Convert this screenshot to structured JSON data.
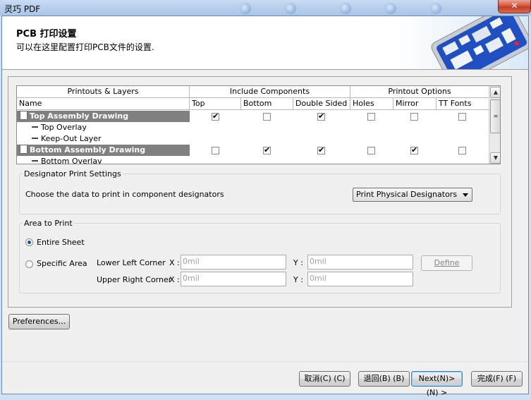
{
  "window": {
    "title": "灵巧 PDF",
    "close_glyph": "✕"
  },
  "header": {
    "title": "PCB 打印设置",
    "subtitle": "可以在这里配置打印PCB文件的设置."
  },
  "grid": {
    "group_headers": [
      "Printouts & Layers",
      "Include Components",
      "Printout Options"
    ],
    "columns": [
      "Name",
      "Top",
      "Bottom",
      "Double Sided",
      "Holes",
      "Mirror",
      "TT Fonts"
    ],
    "rows": [
      {
        "name": "Top Assembly Drawing",
        "kind": "printout",
        "selected": true,
        "checks": [
          true,
          false,
          true,
          false,
          false,
          false
        ]
      },
      {
        "name": "Top Overlay",
        "kind": "layer"
      },
      {
        "name": "Keep-Out Layer",
        "kind": "layer"
      },
      {
        "name": "Bottom Assembly Drawing",
        "kind": "printout",
        "selected": true,
        "checks": [
          false,
          true,
          true,
          false,
          true,
          false
        ]
      },
      {
        "name": "Bottom Overlav",
        "kind": "layer"
      }
    ],
    "check_glyph": "✔"
  },
  "designator": {
    "title": "Designator Print Settings",
    "label": "Choose the data to print in component designators",
    "selected": "Print Physical Designators"
  },
  "area": {
    "title": "Area to Print",
    "options": [
      "Entire Sheet",
      "Specific Area"
    ],
    "selected_index": 0,
    "lower_left_label": "Lower Left Corner",
    "upper_right_label": "Upper Right Corner",
    "x_label": "X :",
    "y_label": "Y :",
    "lower_left_x": "0mil",
    "lower_left_y": "0mil",
    "upper_right_x": "0mil",
    "upper_right_y": "0mil",
    "define_label": "Define"
  },
  "buttons": {
    "preferences": "Preferences...",
    "cancel": "取消(C) (C)",
    "back": "退回(B) (B)",
    "next": "Next(N)> (N) >",
    "finish": "完成(F) (F)"
  }
}
